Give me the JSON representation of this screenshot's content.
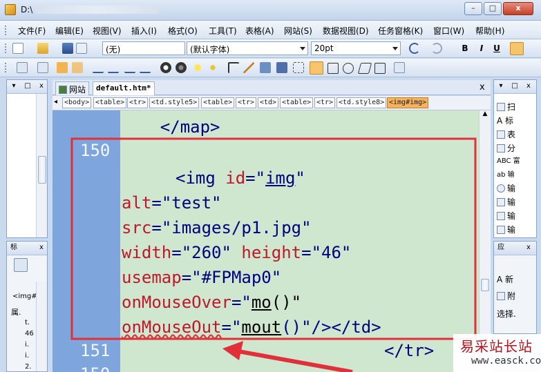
{
  "window": {
    "title": "D:\\",
    "buttons": {
      "minimize": "–",
      "maximize": "□",
      "close": "x"
    }
  },
  "menu": [
    "文件(F)",
    "编辑(E)",
    "视图(V)",
    "插入(I)",
    "格式(O)",
    "工具(T)",
    "表格(A)",
    "网站(S)",
    "数据视图(D)",
    "任务窗格(K)",
    "窗口(W)",
    "帮助(H)"
  ],
  "format_toolbar": {
    "style_value": "(无)",
    "font_value": "(默认字体)",
    "size_value": "20pt",
    "bold": "B",
    "italic": "I",
    "underline": "U"
  },
  "left_panels": {
    "top_head": {
      "close": "x",
      "restore": "□",
      "pin": "▾"
    },
    "bottom_head": {
      "title": "标",
      "items": [
        "<img#",
        "属.",
        "t.",
        "46",
        "i.",
        "i.",
        "2."
      ]
    }
  },
  "tabs": [
    {
      "label": "网站",
      "icon": "site-icon"
    },
    {
      "label": "default.htm*",
      "icon": ""
    }
  ],
  "tab_close": "x",
  "tag_path": [
    "<body>",
    "<table>",
    "<tr>",
    "<td.style5>",
    "<table>",
    "<tr>",
    "<td>",
    "<table>",
    "<tr>",
    "<td.style8>",
    "<img#img>"
  ],
  "code": {
    "line_map_close": "    </map>",
    "ln_150": "150",
    "ln_151": "151",
    "ln_152": "150",
    "img_open": "<img",
    "id_attr": "id",
    "eq": "=",
    "id_value": "img",
    "alt_attr": "alt",
    "alt_value": "\"test\"",
    "src_attr": "src",
    "src_value": "\"images/p1.jpg\"",
    "width_attr": "width",
    "width_value": "\"260\"",
    "height_attr": "height",
    "height_value": "\"46\"",
    "usemap_attr": "usemap",
    "usemap_value": "\"#FPMap0\"",
    "over_attr": "onMouseOver",
    "over_value": "mo",
    "over_paren": "()\"",
    "out_attr": "onMouseOut",
    "out_value": "mout",
    "out_tail": "()\"/></td>",
    "tr_close": "</tr>"
  },
  "right_panels": {
    "top_items": [
      "扫",
      "A 标",
      "表",
      "分",
      "ABC 富",
      "ab 输",
      "输",
      "输",
      "输",
      "输"
    ],
    "bottom_title": "应",
    "bottom_items": [
      "A 新",
      "附",
      "选择."
    ]
  },
  "watermark": {
    "cn": "易采站长站",
    "url": "www.easck.com"
  },
  "colors": {
    "highlight_box": "#e0303a",
    "arrow": "#e0303a",
    "gutter": "#7fa6dc",
    "editor_bg": "#cfe7cf"
  }
}
